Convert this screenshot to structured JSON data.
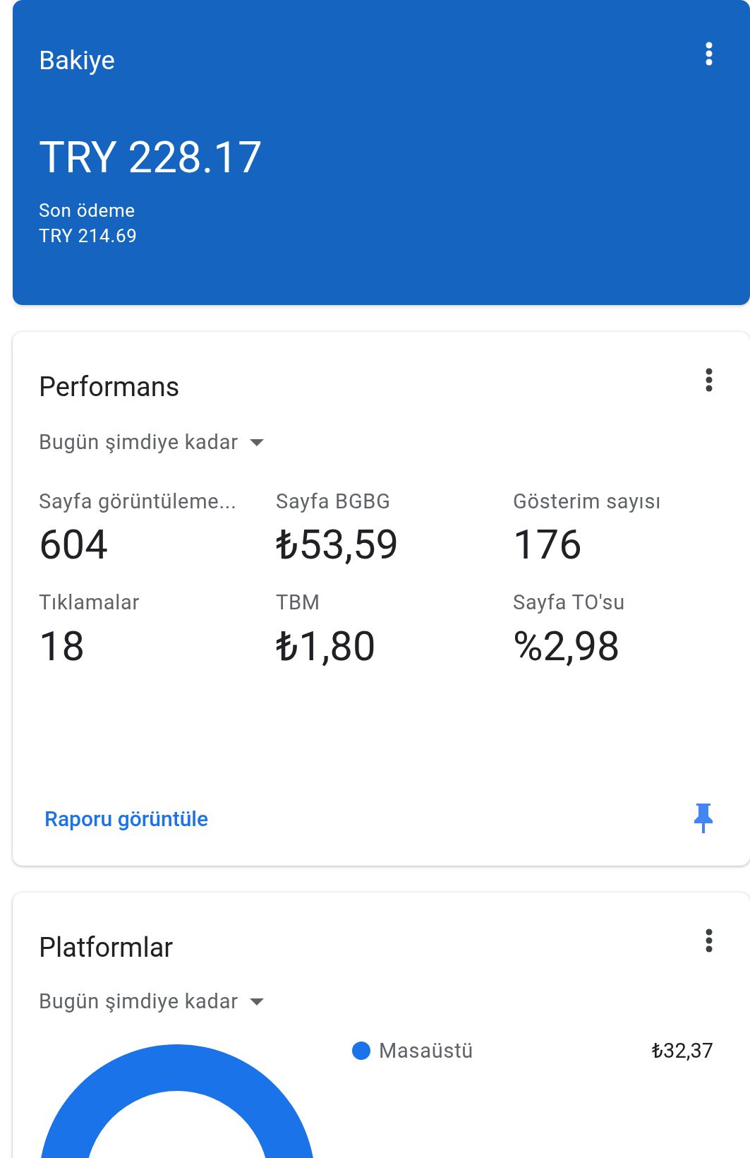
{
  "balance_card": {
    "title": "Bakiye",
    "amount": "TRY 228.17",
    "last_payment_label": "Son ödeme",
    "last_payment_amount": "TRY 214.69"
  },
  "performance_card": {
    "title": "Performans",
    "period": "Bugün şimdiye kadar",
    "metrics": [
      {
        "label": "Sayfa görüntüleme...",
        "value": "604"
      },
      {
        "label": "Sayfa BGBG",
        "value": "₺53,59"
      },
      {
        "label": "Gösterim sayısı",
        "value": "176"
      },
      {
        "label": "Tıklamalar",
        "value": "18"
      },
      {
        "label": "TBM",
        "value": "₺1,80"
      },
      {
        "label": "Sayfa TO'su",
        "value": "%2,98"
      }
    ],
    "link": "Raporu görüntüle"
  },
  "platforms_card": {
    "title": "Platformlar",
    "period": "Bugün şimdiye kadar",
    "legend": [
      {
        "label": "Masaüstü",
        "value": "₺32,37",
        "color": "#1a73e8"
      }
    ]
  }
}
